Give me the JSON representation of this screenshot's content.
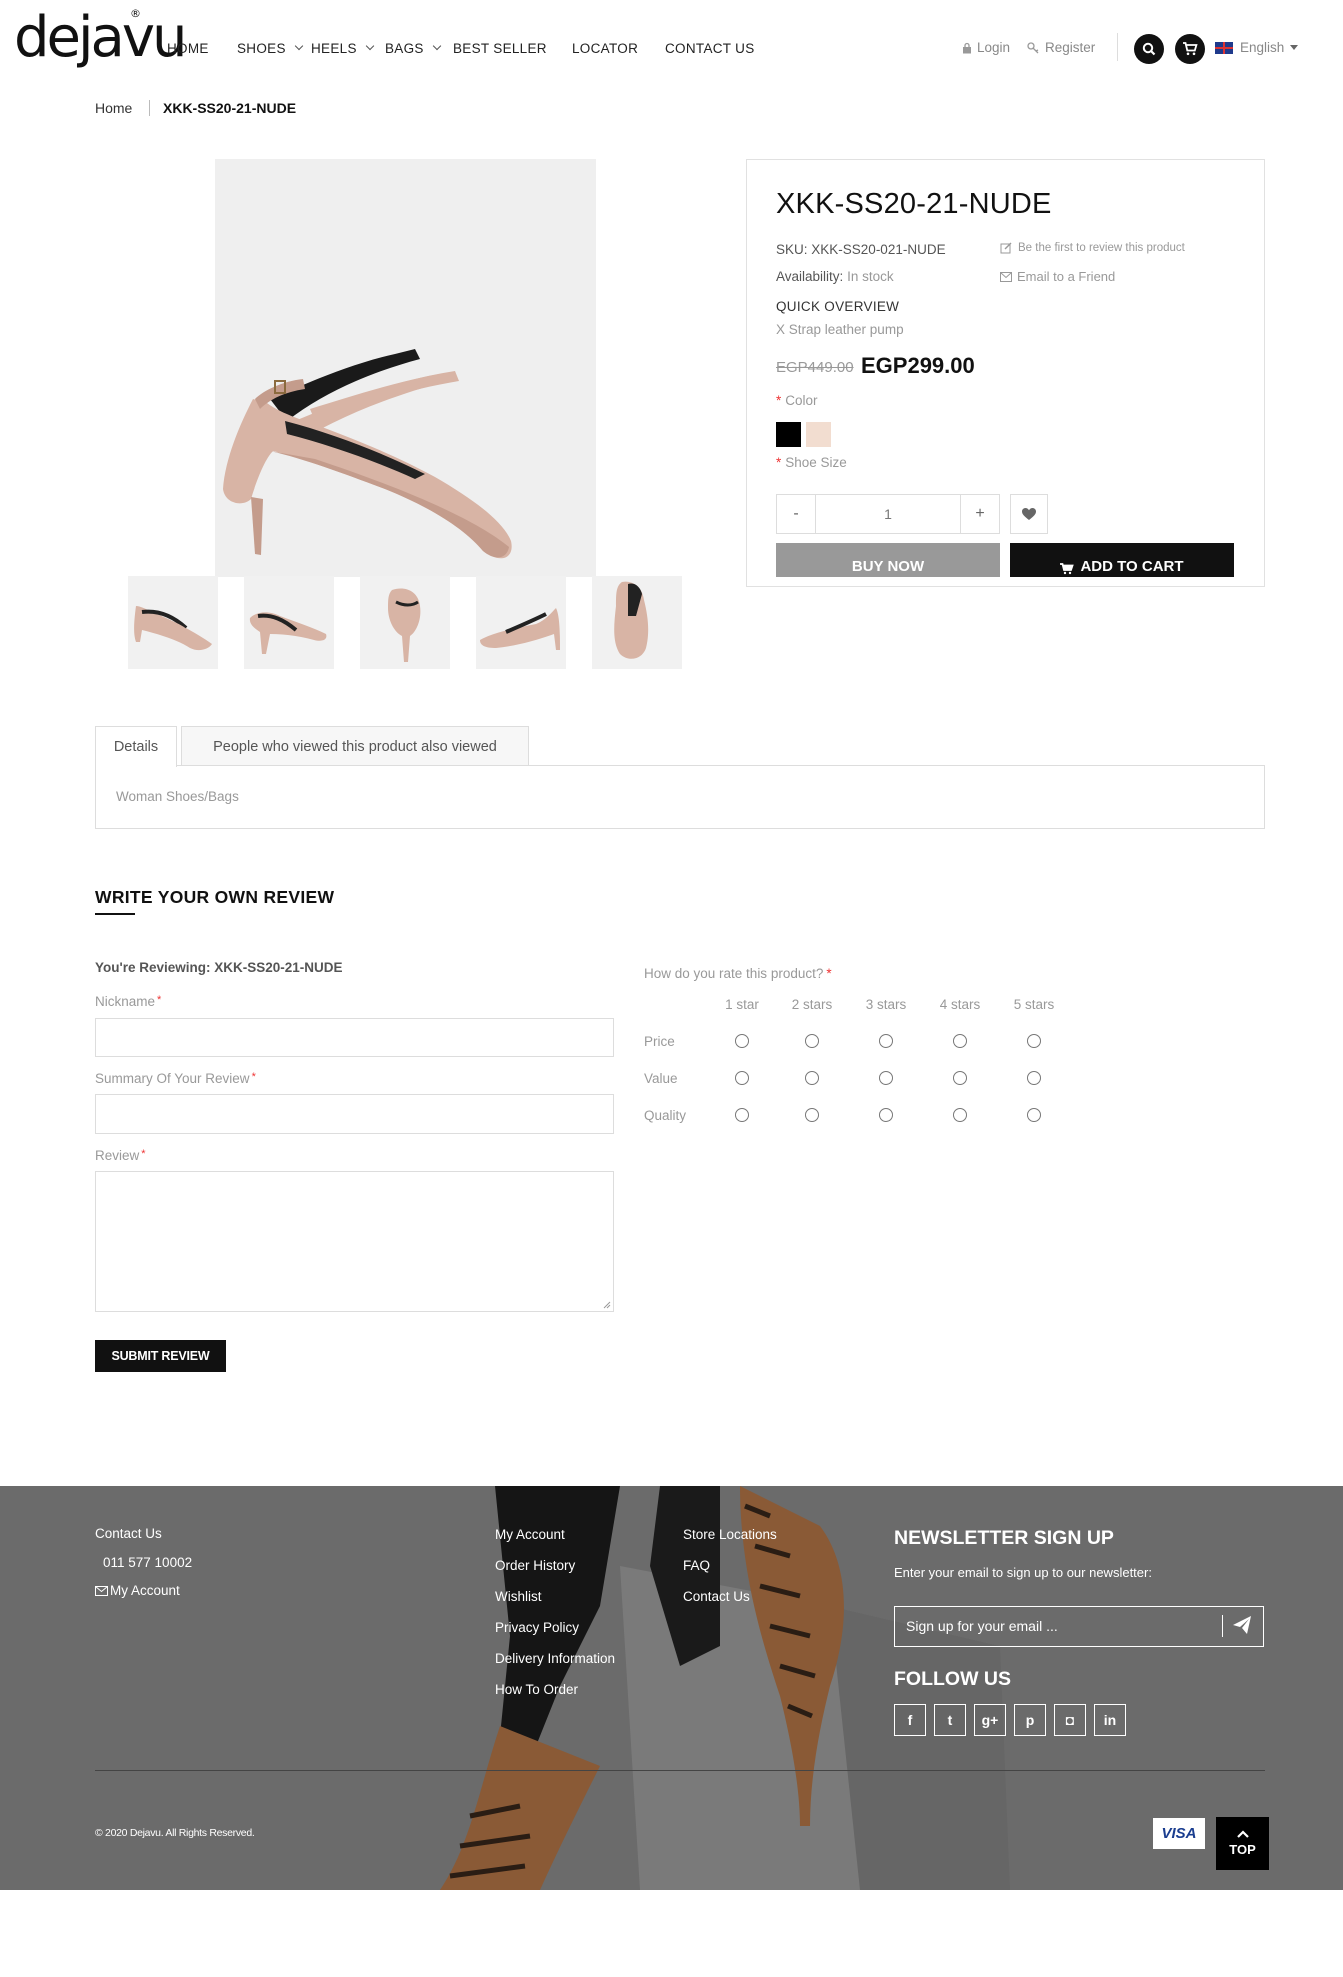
{
  "header": {
    "logo_text": "dejavu",
    "logo_reg": "®",
    "nav": [
      {
        "label": "HOME"
      },
      {
        "label": "SHOES"
      },
      {
        "label": "HEELS"
      },
      {
        "label": "BAGS"
      },
      {
        "label": "BEST SELLER"
      },
      {
        "label": "LOCATOR"
      },
      {
        "label": "CONTACT US"
      }
    ],
    "login": "Login",
    "register": "Register",
    "language": "English"
  },
  "breadcrumb": {
    "home": "Home",
    "current": "XKK-SS20-21-NUDE"
  },
  "product": {
    "title": "XKK-SS20-21-NUDE",
    "sku_label": "SKU:",
    "sku": "XKK-SS20-021-NUDE",
    "availability_label": "Availability:",
    "availability": "In stock",
    "review_link": "Be the first to review this product",
    "email_link": "Email to a Friend",
    "quick_overview_heading": "QUICK OVERVIEW",
    "quick_overview_text": "X Strap leather pump",
    "old_price": "EGP449.00",
    "price": "EGP299.00",
    "color_label": "Color",
    "size_label": "Shoe Size",
    "swatches": [
      "#000000",
      "#f2ddd0"
    ],
    "qty_minus": "-",
    "qty": "1",
    "qty_plus": "+",
    "buy_now": "BUY NOW",
    "add_to_cart": "ADD TO CART"
  },
  "tabs": {
    "details": "Details",
    "also_viewed": "People who viewed this product also viewed",
    "details_text": "Woman Shoes/Bags"
  },
  "review": {
    "heading": "WRITE YOUR OWN REVIEW",
    "reviewing_label": "You're Reviewing:",
    "reviewing_product": "XKK-SS20-21-NUDE",
    "nickname_label": "Nickname",
    "summary_label": "Summary Of Your Review",
    "review_label": "Review",
    "required_mark": "*",
    "submit": "SUBMIT REVIEW",
    "rating_question": "How do you rate this product?",
    "rating_columns": [
      "1 star",
      "2 stars",
      "3 stars",
      "4 stars",
      "5 stars"
    ],
    "rating_rows": [
      "Price",
      "Value",
      "Quality"
    ]
  },
  "footer": {
    "contact_heading": "Contact Us",
    "phone": "011 577 10002",
    "my_account_contact": "My Account",
    "col2": [
      "My Account",
      "Order History",
      "Wishlist",
      "Privacy Policy",
      "Delivery Information",
      "How To Order"
    ],
    "col3": [
      "Store Locations",
      "FAQ",
      "Contact Us"
    ],
    "newsletter_heading": "NEWSLETTER SIGN UP",
    "newsletter_text": "Enter your email to sign up to our newsletter:",
    "newsletter_placeholder": "Sign up for your email ...",
    "follow_heading": "FOLLOW US",
    "social": [
      {
        "icon": "facebook-icon",
        "glyph": "f"
      },
      {
        "icon": "twitter-icon",
        "glyph": "t"
      },
      {
        "icon": "google-plus-icon",
        "glyph": "g+"
      },
      {
        "icon": "pinterest-icon",
        "glyph": "p"
      },
      {
        "icon": "instagram-icon",
        "glyph": "◘"
      },
      {
        "icon": "linkedin-icon",
        "glyph": "in"
      }
    ],
    "copyright": "© 2020 Dejavu. All Rights Reserved.",
    "payment": "VISA",
    "top": "TOP"
  },
  "colors": {
    "accent": "#111111",
    "footer_bg": "#6b6b6b",
    "shoe": "#d8b4a5",
    "required": "#e33333"
  }
}
